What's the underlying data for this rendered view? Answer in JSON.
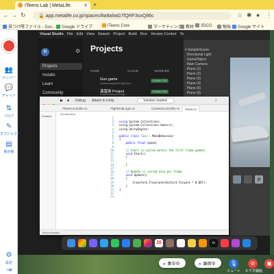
{
  "browser": {
    "tab_title": "ITeens Lab | MetaLife",
    "new_tab": "+",
    "url": "app.metalife.co.jp/spaces/8a9a9aG7fQRF3sxQ86c",
    "back": "←",
    "forward": "→",
    "reload": "↻",
    "bookmarks": [
      {
        "label": "見つけ隊ファイル - Doc...",
        "color": "#4285f4"
      },
      {
        "label": "Google ドライブ",
        "color": "#34a853"
      },
      {
        "label": "ITeens Core",
        "color": "#f29b1d"
      },
      {
        "label": "マーケティング",
        "color": "#888888"
      },
      {
        "label": "教材",
        "color": "#888888"
      },
      {
        "label": "3DCG",
        "color": "#888888"
      },
      {
        "label": "勉強",
        "color": "#888888"
      },
      {
        "label": "Google サイト",
        "color": "#4285f4"
      },
      {
        "label": "ダッシュボード - Ste...",
        "color": "#888888"
      }
    ]
  },
  "metalife": {
    "sidebar": [
      {
        "icon": "people-icon",
        "glyph": "👥",
        "label": "メンバー"
      },
      {
        "icon": "chat-icon",
        "glyph": "💬",
        "label": "チャット"
      },
      {
        "icon": "floor-icon",
        "glyph": "⇅",
        "label": "フロア"
      },
      {
        "icon": "object-icon",
        "glyph": "✎",
        "label": "オブジェクト"
      },
      {
        "icon": "bulletin-icon",
        "glyph": "▤",
        "label": "掲示板"
      }
    ],
    "settings_label": "設定",
    "exit_label": "退出",
    "pill_left": "集中中",
    "pill_right": "離席中",
    "mute_label": "ミュート",
    "video_label": "ビデオ開始"
  },
  "hub": {
    "menubar": [
      "Visual Studio",
      "File",
      "Edit",
      "View",
      "Search",
      "Project",
      "Build",
      "Run",
      "Version Control",
      "Tools",
      "Window",
      "Help"
    ],
    "avatar_initial": "M",
    "nav": [
      "Projects",
      "Installs",
      "Learn",
      "Community"
    ],
    "title": "Projects",
    "columns": [
      "NAME",
      "CLOUD",
      "MODIFIED"
    ],
    "projects": [
      {
        "name": "Gun game",
        "path": "/Users/sample/Unity/Gun...",
        "badge": "CONNECTED"
      },
      {
        "name": "演習用 Project",
        "path": "/Users/sample/Unity/...",
        "badge": "CONNECTED"
      }
    ]
  },
  "vs": {
    "debug_label": "Debug",
    "attach_label": "Attach to Unity",
    "build_label": "Solution loaded.",
    "tabs": [
      "PlaneController.cs",
      "FlightHudLogic.cs",
      "CameraController.cs",
      "Tama.cs"
    ],
    "active_tab_index": 3,
    "breadcrumb": "No selection",
    "solution_label": "Solution",
    "status": "Build successful",
    "line_numbers": [
      "1",
      "2",
      "3",
      "4",
      "5",
      "6",
      "7",
      "8",
      "9",
      "10",
      "11",
      "12",
      "13",
      "14",
      "15",
      "16",
      "17",
      "18",
      "19",
      "20",
      "21",
      "22",
      "23"
    ],
    "code": {
      "l1": "using System.Collections;",
      "l2": "using System.Collections.Generic;",
      "l3": "using UnityEngine;",
      "l5_kw": "public class",
      "l5_ty": "Tama",
      "l5_rest": " : MonoBehaviour",
      "l6": "{",
      "l7_kw": "    public float",
      "l7_rest": " speed;",
      "l9": "    // Start is called before the first frame update",
      "l10_kw": "    void",
      "l10_rest": " Start()",
      "l11": "    {",
      "l13": "    }",
      "l15": "    // Update is called once per frame",
      "l16_kw": "    void",
      "l16_rest": " Update()",
      "l17": "    {",
      "l18": "        transform.Translate(Vector3.forward * 0.05f);",
      "l19": "    }",
      "l20": "}"
    }
  },
  "dock": {
    "calendar_day": "26",
    "tv_label": "tv"
  }
}
